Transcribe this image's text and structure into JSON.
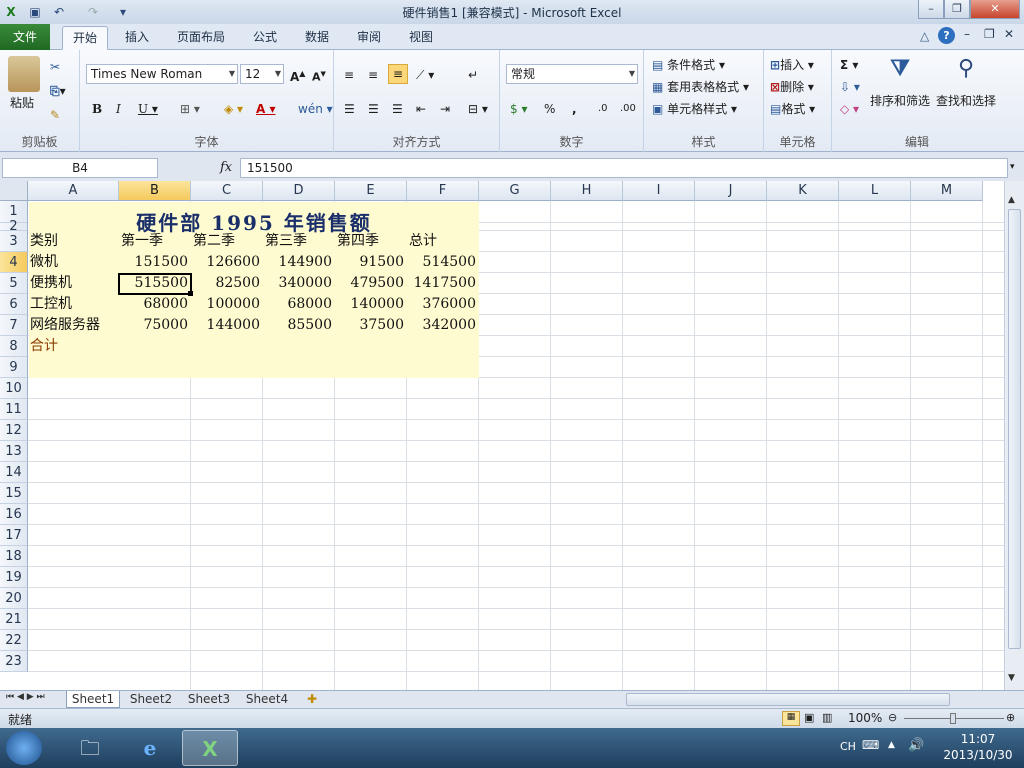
{
  "window": {
    "title": "硬件销售1  [兼容模式]  -  Microsoft Excel",
    "controls": [
      "–",
      "❐",
      "✕"
    ]
  },
  "tabs": [
    {
      "label": "文件",
      "active": false
    },
    {
      "label": "开始",
      "active": true
    },
    {
      "label": "插入",
      "active": false
    },
    {
      "label": "页面布局",
      "active": false
    },
    {
      "label": "公式",
      "active": false
    },
    {
      "label": "数据",
      "active": false
    },
    {
      "label": "审阅",
      "active": false
    },
    {
      "label": "视图",
      "active": false
    }
  ],
  "ribbon": {
    "clipboard": {
      "label": "剪贴板",
      "paste": "粘贴"
    },
    "font": {
      "label": "字体",
      "family": "Times New Roman",
      "size": "12"
    },
    "alignment": {
      "label": "对齐方式"
    },
    "number": {
      "label": "数字",
      "format": "常规"
    },
    "styles": {
      "label": "样式",
      "conditional": "条件格式",
      "table": "套用表格格式",
      "cell": "单元格样式"
    },
    "cells": {
      "label": "单元格",
      "insert": "插入",
      "delete": "删除",
      "format": "格式"
    },
    "editing": {
      "label": "编辑",
      "sort": "排序和筛选",
      "find": "查找和选择"
    }
  },
  "formula_bar": {
    "name_box": "B4",
    "fx": "fx",
    "value": "151500"
  },
  "columns": [
    "A",
    "B",
    "C",
    "D",
    "E",
    "F",
    "G",
    "H",
    "I",
    "J",
    "K",
    "L",
    "M"
  ],
  "rows": [
    "1",
    "2",
    "3",
    "4",
    "5",
    "6",
    "7",
    "8",
    "9",
    "10",
    "11",
    "12",
    "13",
    "14",
    "15",
    "16",
    "17",
    "18",
    "19",
    "20",
    "21",
    "22",
    "23"
  ],
  "sheet": {
    "title": "硬件部  1995  年销售额",
    "headers": [
      "类别",
      "第一季",
      "第二季",
      "第三季",
      "第四季",
      "总计"
    ],
    "data": [
      [
        "微机",
        "151500",
        "126600",
        "144900",
        "91500",
        "514500"
      ],
      [
        "便携机",
        "515500",
        "82500",
        "340000",
        "479500",
        "1417500"
      ],
      [
        "工控机",
        "68000",
        "100000",
        "68000",
        "140000",
        "376000"
      ],
      [
        "网络服务器",
        "75000",
        "144000",
        "85500",
        "37500",
        "342000"
      ]
    ],
    "total_label": "合计",
    "selected_cell": "B4"
  },
  "sheet_tabs": [
    "Sheet1",
    "Sheet2",
    "Sheet3",
    "Sheet4"
  ],
  "status": {
    "ready": "就绪",
    "zoom": "100%"
  },
  "taskbar": {
    "lang": "CH",
    "time": "11:07",
    "date": "2013/10/30"
  },
  "colors": {
    "table_fill": "#fffbd0",
    "title_color": "#1a2f6a",
    "total_color": "#8a3b00",
    "file_tab": "#2e7d32"
  }
}
